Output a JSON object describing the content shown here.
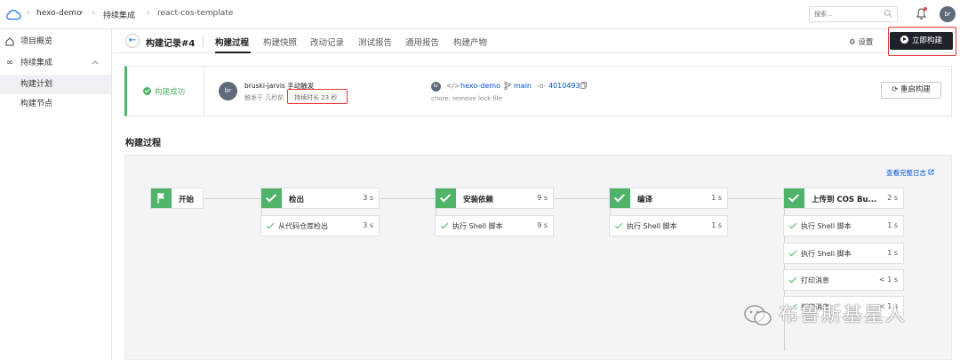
{
  "topbar": {
    "project": "hexo-demo",
    "section": "持续集成",
    "repo": "react-cos-template",
    "search_placeholder": "搜索...",
    "avatar": "br"
  },
  "sidebar": {
    "items": [
      {
        "label": "项目概览",
        "icon": "home-icon"
      },
      {
        "label": "持续集成",
        "icon": "infinity-icon"
      },
      {
        "label": "构建计划"
      },
      {
        "label": "构建节点"
      }
    ]
  },
  "header": {
    "title": "构建记录#4",
    "tabs": [
      "构建过程",
      "构建快照",
      "改动记录",
      "测试报告",
      "通用报告",
      "构建产物"
    ],
    "settings_label": "设置",
    "run_label": "立即构建"
  },
  "summary": {
    "status": "构建成功",
    "avatar": "br",
    "trigger_user": "bruski-jarvis 手动触发",
    "trigger_time": "触发于 几秒前",
    "duration": "持续时长 23 秒",
    "repo_avatar": "br",
    "repo_name": "hexo-demo",
    "branch": "main",
    "commit": "4010493",
    "commit_message": "chore: remove lock file",
    "rebuild_label": "重启构建"
  },
  "pipeline": {
    "section_title": "构建过程",
    "full_log_label": "查看完整日志",
    "start_label": "开始",
    "stages": [
      {
        "name": "检出",
        "time": "3 s",
        "steps": [
          {
            "name": "从代码仓库检出",
            "time": "3 s"
          }
        ]
      },
      {
        "name": "安装依赖",
        "time": "9 s",
        "steps": [
          {
            "name": "执行 Shell 脚本",
            "time": "9 s"
          }
        ]
      },
      {
        "name": "编译",
        "time": "1 s",
        "steps": [
          {
            "name": "执行 Shell 脚本",
            "time": "1 s"
          }
        ]
      },
      {
        "name": "上传到 COS Bu...",
        "time": "2 s",
        "steps": [
          {
            "name": "执行 Shell 脚本",
            "time": "1 s"
          },
          {
            "name": "执行 Shell 脚本",
            "time": "1 s"
          },
          {
            "name": "打印消息",
            "time": "< 1 s"
          },
          {
            "name": "打印消息",
            "time": "< 1 s"
          }
        ]
      }
    ]
  },
  "watermark": "布鲁斯基星人",
  "colors": {
    "success": "#4fb36a",
    "primary": "#0052d9",
    "dark_button": "#1f2329",
    "highlight": "#e53935"
  }
}
